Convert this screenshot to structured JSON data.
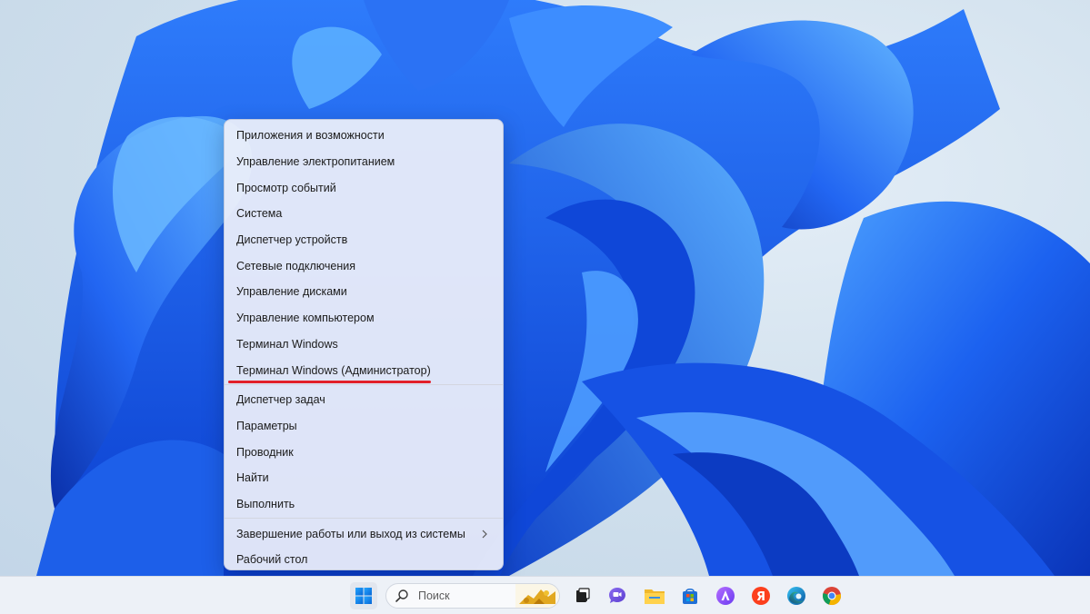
{
  "context_menu": {
    "items": [
      {
        "label": "Приложения и возможности"
      },
      {
        "label": "Управление электропитанием"
      },
      {
        "label": "Просмотр событий"
      },
      {
        "label": "Система"
      },
      {
        "label": "Диспетчер устройств"
      },
      {
        "label": "Сетевые подключения"
      },
      {
        "label": "Управление дисками"
      },
      {
        "label": "Управление компьютером"
      },
      {
        "label": "Терминал Windows"
      },
      {
        "label": "Терминал Windows (Администратор)"
      },
      {
        "label": "Диспетчер задач"
      },
      {
        "label": "Параметры"
      },
      {
        "label": "Проводник"
      },
      {
        "label": "Найти"
      },
      {
        "label": "Выполнить"
      },
      {
        "label": "Завершение работы или выход из системы"
      },
      {
        "label": "Рабочий стол"
      }
    ],
    "highlighted_item": "Терминал Windows (Администратор)",
    "highlight_color": "#e2202a"
  },
  "taskbar": {
    "search_placeholder": "Поиск",
    "icons": [
      "windows-start-icon",
      "search-icon",
      "task-view-icon",
      "teams-chat-icon",
      "file-explorer-icon",
      "microsoft-store-icon",
      "alice-assistant-icon",
      "yandex-browser-icon",
      "edge-browser-icon",
      "chrome-browser-icon"
    ],
    "yandex_letter": "Я"
  },
  "colors": {
    "accent": "#0067c0",
    "wallpaper_bloom": "#1a5ae8",
    "taskbar_bg": "#edf1f7"
  }
}
